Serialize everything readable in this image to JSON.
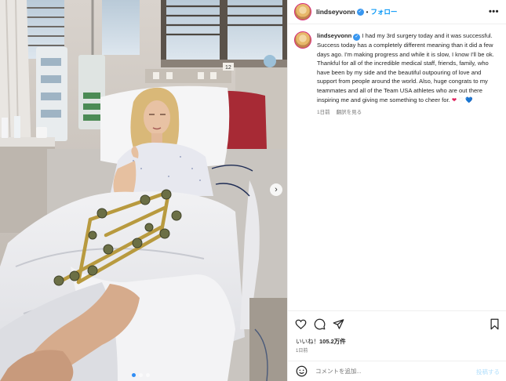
{
  "post": {
    "username": "lindseyvonn",
    "separator": "•",
    "follow_label": "フォロー",
    "more_label": "•••",
    "caption": "I had my 3rd surgery today and it was successful. Success today has a completely different meaning than it did a few days ago. I'm making progress and while it is slow, I know I'll be ok. Thankful for all of the incredible medical staff, friends, family, who have been by my side and the beautiful outpouring of love and support from people around the world. Also, huge congrats to my teammates and all of the Team USA athletes who are out there inspiring me and giving me something to cheer for.",
    "hearts": [
      "❤",
      "♡",
      "💙"
    ],
    "caption_age": "1日前",
    "translate_label": "翻訳を見る",
    "likes_prefix": "いいね！",
    "likes_count": "105.2万件",
    "post_date": "1日前"
  },
  "comment": {
    "placeholder": "コメントを追加...",
    "post_label": "投稿する"
  },
  "media": {
    "carousel_dots": 3,
    "active_dot": 0,
    "room_number": "12"
  },
  "colors": {
    "link_blue": "#0095f6",
    "verified_blue": "#3897f0",
    "story_ring": "#d62976"
  },
  "icons": [
    "more-options-icon",
    "verified-icon",
    "heart-icon",
    "comment-icon",
    "share-icon",
    "bookmark-icon",
    "emoji-icon",
    "carousel-next-icon"
  ]
}
